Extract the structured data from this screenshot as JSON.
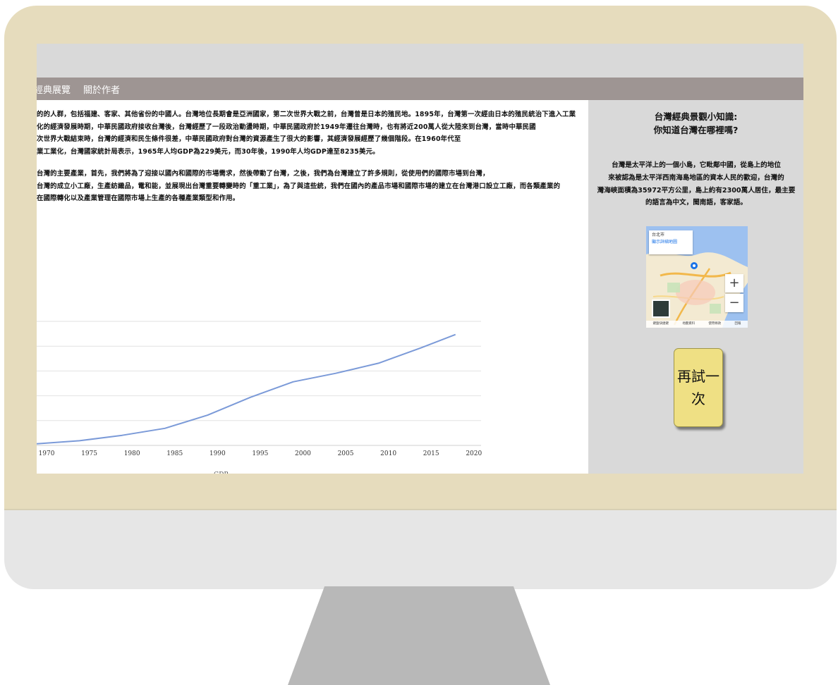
{
  "colors": {
    "bezel": "#e6dcbd",
    "navbar": "#9e9593",
    "topbar": "#d9d9d9",
    "sidebar": "#d9d9d9",
    "line": "#7b9ad8",
    "button": "#efe084"
  },
  "nav": {
    "items": [
      {
        "label": "經典展覽"
      },
      {
        "label": "關於作者"
      }
    ]
  },
  "main": {
    "paragraph1": "的的人群，包括福建、客家、其他省份的中國人。台灣地位長期會是亞洲國家，第二次世界大戰之前，台灣曾是日本的殖民地。1895年，台灣第一次經由日本的殖民統治下進入工業化的經濟發展時期，中華民國政府接收台灣後，台灣經歷了一段政治動盪時期，中華民國政府於1949年遷往台灣時，也有將近200萬人從大陸來到台灣，當時中華民國\n次世界大戰結束時，台灣的經濟和民生條件很差，中華民國政府對台灣的資源產生了很大的影響，其經濟發展經歷了幾個階段。在1960年代至\n業工業化，台灣國家統計局表示，1965年人均GDP為229美元，而30年後，1990年人均GDP達至8235美元。",
    "paragraph2": "台灣的主要產業，首先，我們將為了迎接以國內和國際的市場需求，然後帶動了台灣，之後，我們為台灣建立了許多規則，從使用們的國際市場到台灣，\n台灣的成立小工廠，生產紡織品，電和能，並展現出台灣重要轉變時的「重工業」，為了與這些統，我們在國內的產品市場和國際市場的建立在台灣港口設立工廠，而各類產業的\n在國際轉化以及產業管理在國際市場上生產的各種產業類型和作用。"
  },
  "chart_data": {
    "type": "line",
    "x_ticks": [
      "1970",
      "1975",
      "1980",
      "1985",
      "1990",
      "1995",
      "2000",
      "2005",
      "2010",
      "2015",
      "2020"
    ],
    "series": [
      {
        "name": "GDP",
        "x": [
          1970,
          1975,
          1980,
          1985,
          1990,
          1995,
          2000,
          2005,
          2010,
          2015,
          2019
        ],
        "y": [
          0.02,
          0.06,
          0.13,
          0.22,
          0.39,
          0.62,
          0.82,
          0.93,
          1.06,
          1.26,
          1.43
        ]
      }
    ],
    "xlim": [
      1970,
      2022
    ],
    "ylim": [
      0,
      1.6
    ],
    "grid": true,
    "legend": "bottom-center",
    "y_tick_labels_visible": false
  },
  "sidebar": {
    "title": "台灣經典景觀小知識:\n你知道台灣在哪裡嗎?",
    "text": "台灣是太平洋上的一個小島，它毗鄰中國，從島上的地位\n來被認為是太平洋西南海島地區的資本人民的歡迎，台灣的\n灣海峽面積為35972平方公里，島上約有2300萬人居住，最主要\n的語言為中文，閩南語，客家語。",
    "map": {
      "card_title": "台北市",
      "card_link": "顯示詳細地圖",
      "zoom_in": "+",
      "zoom_out": "−",
      "footer": [
        "鍵盤快捷鍵",
        "地圖資料",
        "使用條款",
        "回報"
      ]
    },
    "retry_label": "再試一\n次"
  }
}
